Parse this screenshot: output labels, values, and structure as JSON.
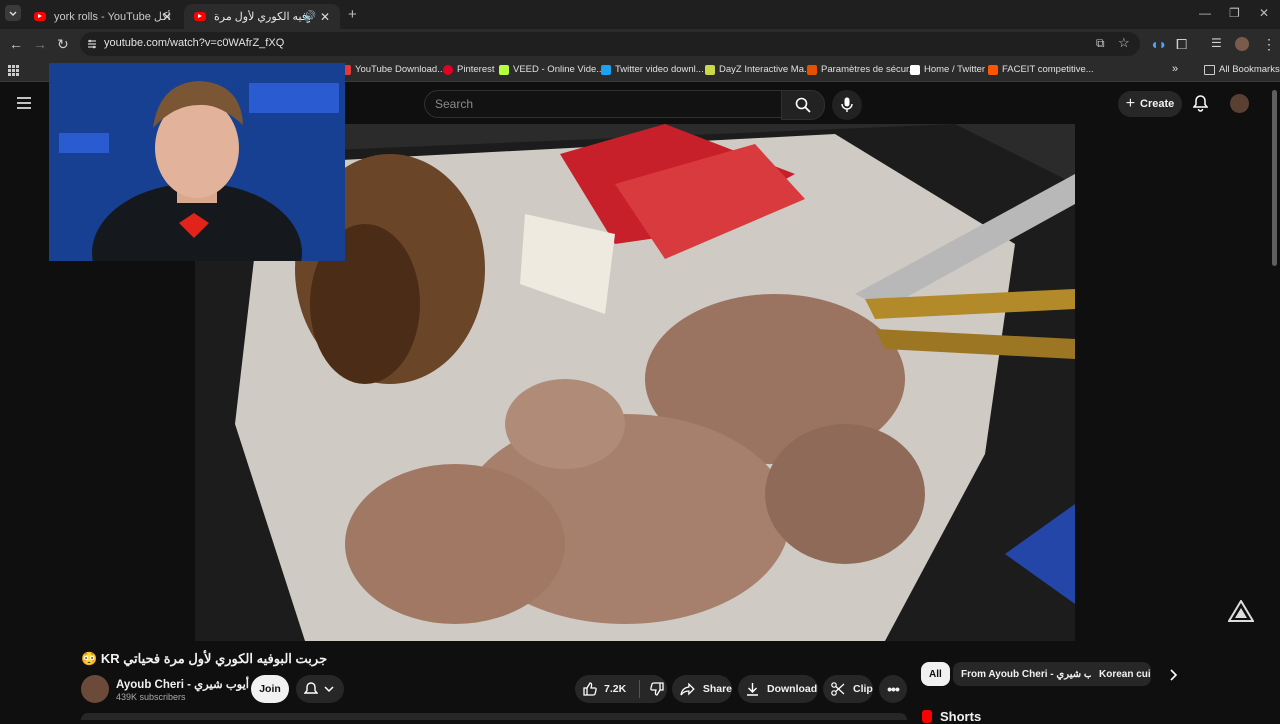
{
  "browser": {
    "tabs": [
      {
        "title": "york rolls - YouTube تحدي أكل",
        "active": false
      },
      {
        "title": "جربت البوفيه الكوري لأول مرة",
        "active": true
      }
    ],
    "new_tab_label": "+",
    "url": "youtube.com/watch?v=c0WAfrZ_fXQ",
    "bookmarks": [
      {
        "label": "YouTube Download...",
        "icon": "youtube-download-icon",
        "color": "#e53935"
      },
      {
        "label": "Pinterest",
        "icon": "pinterest-icon",
        "color": "#e60023"
      },
      {
        "label": "VEED - Online Vide...",
        "icon": "veed-icon",
        "color": "#b5ff3b"
      },
      {
        "label": "Twitter video downl...",
        "icon": "twitter-download-icon",
        "color": "#1da1f2"
      },
      {
        "label": "DayZ Interactive Ma...",
        "icon": "dayz-icon",
        "color": "#c9d94a"
      },
      {
        "label": "Paramètres de sécur...",
        "icon": "settings-icon",
        "color": "#e65100"
      },
      {
        "label": "Home / Twitter",
        "icon": "x-icon",
        "color": "#ffffff"
      },
      {
        "label": "FACEIT competitive...",
        "icon": "faceit-icon",
        "color": "#ff5500"
      }
    ],
    "all_bookmarks_label": "All Bookmarks"
  },
  "youtube": {
    "search_placeholder": "Search",
    "create_label": "Create",
    "video_title": "جربت البوفيه الكوري لأول مرة فحياتي KR 😳",
    "channel_name": "Ayoub Cheri - أيوب شيري",
    "subscribers": "439K subscribers",
    "join_label": "Join",
    "like_count": "7.2K",
    "share_label": "Share",
    "download_label": "Download",
    "clip_label": "Clip",
    "chips": [
      "All",
      "From Ayoub Cheri - أيوب شيري",
      "Korean cuisi"
    ],
    "shorts_label": "Shorts"
  },
  "colors": {
    "accent": "#ff0000",
    "bg": "#0f0f0f",
    "pill": "#272727"
  }
}
